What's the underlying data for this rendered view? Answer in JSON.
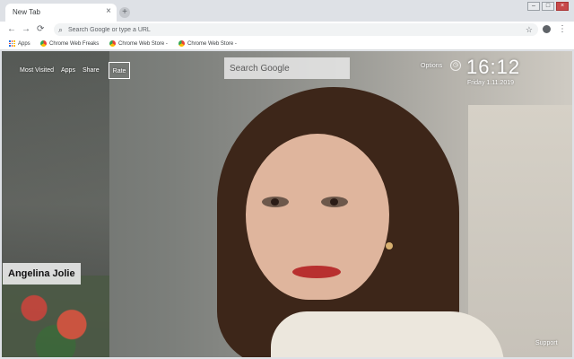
{
  "browser": {
    "tab_title": "New Tab",
    "tab_close_glyph": "×",
    "new_tab_glyph": "+",
    "window_controls": [
      "–",
      "□",
      "×"
    ],
    "omnibox_placeholder": "Search Google or type a URL",
    "nav": {
      "back": "←",
      "forward": "→",
      "reload": "⟳"
    },
    "star_glyph": "☆",
    "menu_glyph": "⋮",
    "bookmarks": [
      {
        "label": "Apps",
        "icon": "apps-grid-icon"
      },
      {
        "label": "Chrome Web Freaks",
        "icon": "chrome-web-store-icon"
      },
      {
        "label": "Chrome Web Store -",
        "icon": "chrome-web-store-icon"
      },
      {
        "label": "Chrome Web Store -",
        "icon": "chrome-web-store-icon"
      }
    ]
  },
  "ntp": {
    "nav": {
      "most_visited": "Most Visited",
      "apps": "Apps",
      "share": "Share",
      "rate": "Rate"
    },
    "search_placeholder": "Search Google",
    "options": "Options",
    "circle_icon_glyph": "◷",
    "time": "16:12",
    "date": "Friday  1.11.2019",
    "caption": "Angelina Jolie",
    "support": "Support"
  },
  "colors": {
    "chrome_bg": "#dee1e6",
    "toolbar_bg": "#ffffff",
    "overlay_text": "#ffffff"
  }
}
